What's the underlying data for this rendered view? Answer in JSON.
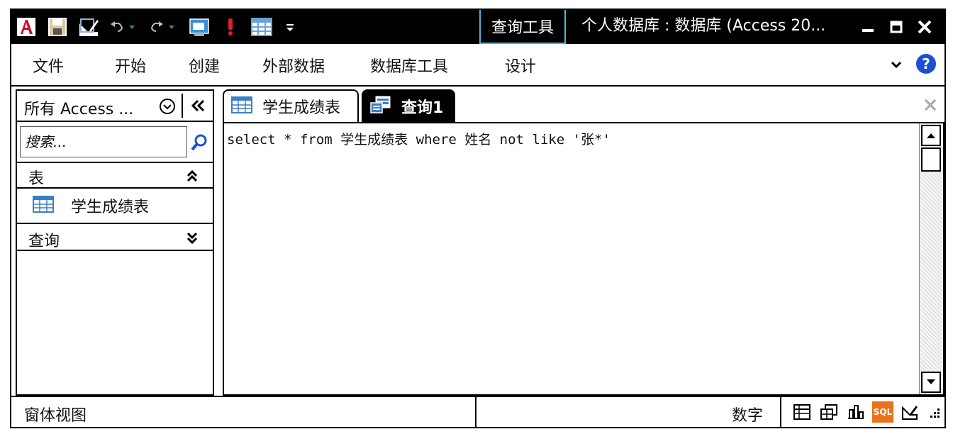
{
  "titlebar": {
    "context_tab": "查询工具",
    "doc_title": "个人数据库 : 数据库 (Access 20...",
    "qat_icons": [
      "access-logo-icon",
      "save-icon",
      "design-edit-icon",
      "undo-icon",
      "redo-icon",
      "sql-view-icon",
      "run-icon",
      "datasheet-icon",
      "customize-qat-icon"
    ]
  },
  "menu": {
    "items": [
      "文件",
      "开始",
      "创建",
      "外部数据",
      "数据库工具",
      "设计"
    ],
    "help": "?"
  },
  "nav": {
    "header": "所有 Access ...",
    "search_placeholder": "搜索...",
    "groups": [
      {
        "label": "表",
        "items": [
          "学生成绩表"
        ]
      },
      {
        "label": "查询",
        "items": []
      }
    ]
  },
  "tabs": [
    {
      "label": "学生成绩表",
      "active": false
    },
    {
      "label": "查询1",
      "active": true
    }
  ],
  "editor": {
    "sql": "select * from 学生成绩表 where 姓名 not like '张*'"
  },
  "status": {
    "left": "窗体视图",
    "num_lock": "数字",
    "sql_badge": "SQL"
  },
  "colors": {
    "accent_tab_border": "#4fb3d8",
    "help_blue": "#1a4fd6",
    "sql_view_active": "#e8731a",
    "access_red": "#c8102e"
  }
}
